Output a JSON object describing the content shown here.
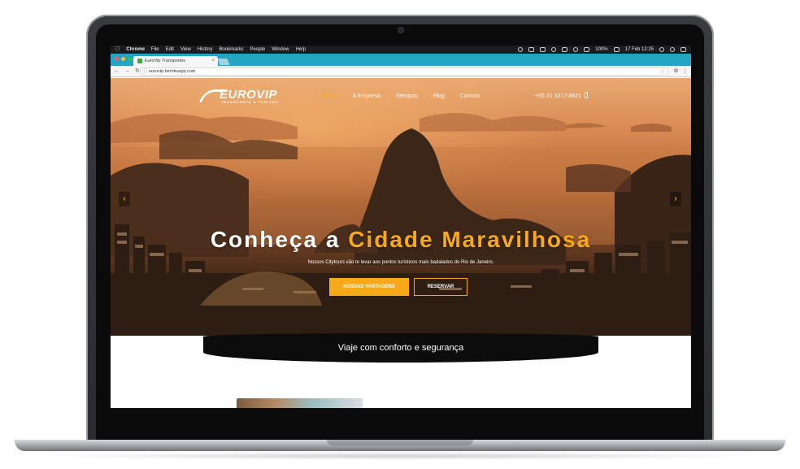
{
  "browser": {
    "menubar": {
      "app_name": "Chrome",
      "menus": [
        "File",
        "Edit",
        "View",
        "History",
        "Bookmarks",
        "People",
        "Window",
        "Help"
      ],
      "battery": "100%",
      "datetime": "17 Feb 12:25"
    },
    "tab_title": "EuroVip Transportes",
    "url": "eurovip.herokuapp.com"
  },
  "site": {
    "logo_text": "EUROVIP",
    "logo_sub": "TRANSPORTE & TURISMO",
    "nav": [
      "Home",
      "A Empresa",
      "Serviços",
      "Blog",
      "Contato"
    ],
    "active_nav": "Home",
    "phone": "+55 21 3217-8621",
    "hero": {
      "title_prefix": "Conheça a ",
      "title_accent": "Cidade Maravilhosa",
      "subtitle": "Nossos Citytours vão te levar aos pontos turísticos mais badalados do Rio de Janeiro.",
      "primary_button": "NOSSAS VANTAGENS",
      "secondary_button": "RESERVAR"
    },
    "tagline": "Viaje com conforto e segurança",
    "colors": {
      "accent": "#f7a917",
      "tabstrip": "#24a4c6",
      "band": "#0c0c0c"
    }
  }
}
